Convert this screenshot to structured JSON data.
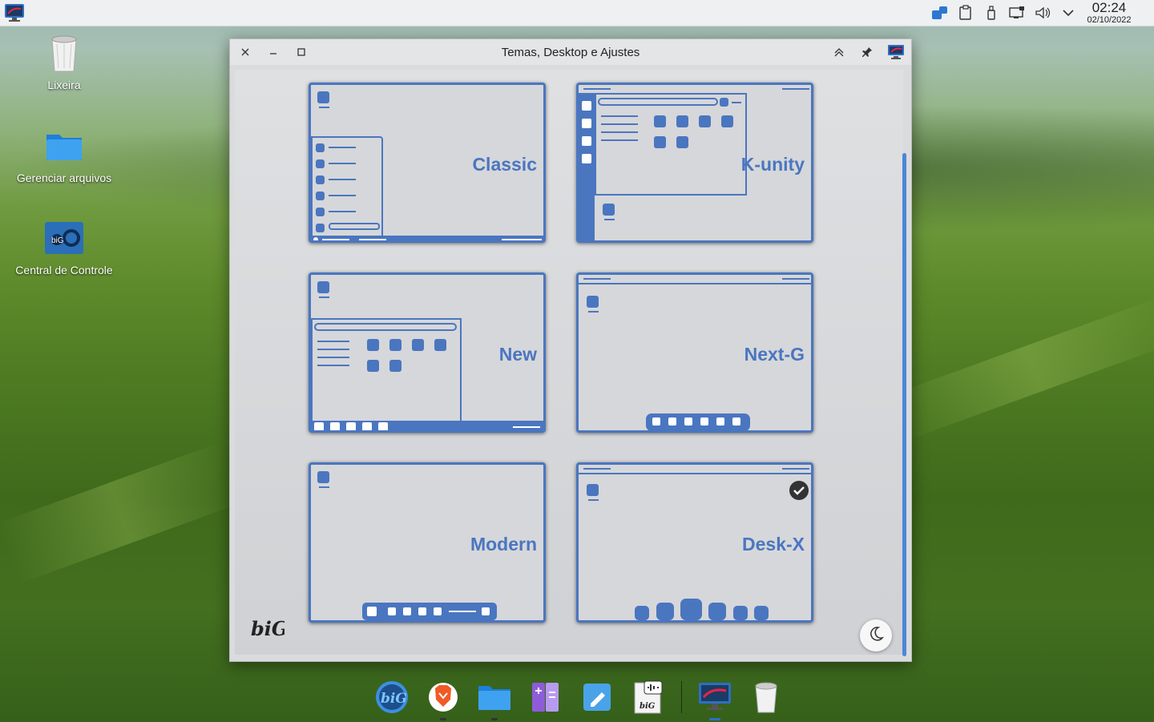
{
  "topbar": {
    "clock_time": "02:24",
    "clock_date": "02/10/2022",
    "tray_icons": [
      "bigcontrol-icon",
      "clipboard-icon",
      "usb-icon",
      "display-icon",
      "volume-icon",
      "expand-tray-icon"
    ]
  },
  "desktop": {
    "icons": [
      {
        "label": "Lixeira",
        "icon": "trash-icon"
      },
      {
        "label": "Gerenciar arquivos",
        "icon": "folder-icon"
      },
      {
        "label": "Central de Controle",
        "icon": "control-center-icon"
      }
    ]
  },
  "window": {
    "title": "Temas, Desktop e Ajustes",
    "layouts": [
      {
        "label": "Classic",
        "selected": false
      },
      {
        "label": "K-unity",
        "selected": false
      },
      {
        "label": "New",
        "selected": false
      },
      {
        "label": "Next-G",
        "selected": false
      },
      {
        "label": "Modern",
        "selected": false
      },
      {
        "label": "Desk-X",
        "selected": true
      }
    ],
    "night_mode_icon": "moon-icon",
    "logo_text": "biG"
  },
  "dock": {
    "items": [
      "big-launcher-icon",
      "brave-browser-icon",
      "file-manager-icon",
      "notes-app-icon",
      "text-editor-icon",
      "bigcontrol-doc-icon",
      "desktop-settings-icon",
      "trash-icon"
    ]
  },
  "colors": {
    "accent": "#4a76c0",
    "panel": "#eef0f2",
    "window_bg": "#dadbdd"
  }
}
